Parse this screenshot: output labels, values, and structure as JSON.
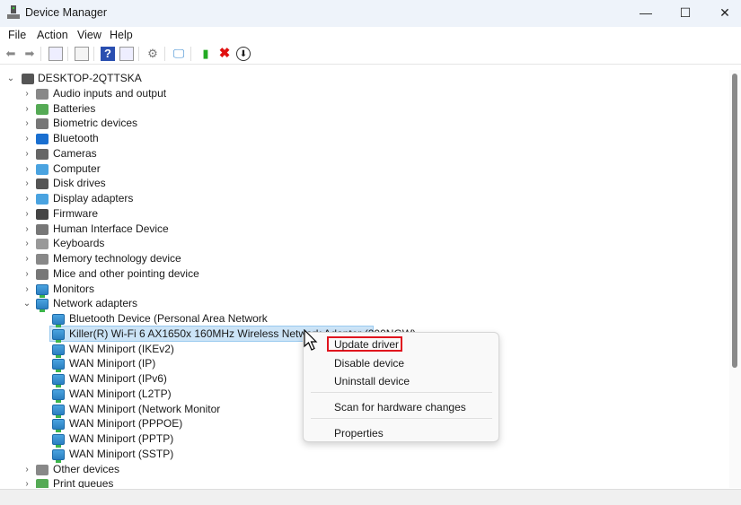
{
  "window": {
    "title": "Device Manager",
    "minimize": "—",
    "maximize": "☐",
    "close": "✕"
  },
  "menubar": [
    "File",
    "Action",
    "View",
    "Help"
  ],
  "toolbar": [
    "back-icon",
    "forward-icon",
    "show-hide-console-tree-icon",
    "properties-icon",
    "help-icon",
    "action-pane-icon",
    "update-driver-icon",
    "scan-hardware-icon",
    "enable-device-icon",
    "uninstall-icon",
    "disable-device-icon"
  ],
  "tree": {
    "root": "DESKTOP-2QTTSKA",
    "categories": [
      "Audio inputs and output",
      "Batteries",
      "Biometric devices",
      "Bluetooth",
      "Cameras",
      "Computer",
      "Disk drives",
      "Display adapters",
      "Firmware",
      "Human Interface Device",
      "Keyboards",
      "Memory technology device",
      "Mice and other pointing device",
      "Monitors",
      "Network adapters"
    ],
    "network_children": [
      "Bluetooth Device (Personal Area Network",
      "Killer(R) Wi-Fi 6 AX1650x 160MHz Wireless Network Adapter (200NGW)",
      "WAN Miniport (IKEv2)",
      "WAN Miniport (IP)",
      "WAN Miniport (IPv6)",
      "WAN Miniport (L2TP)",
      "WAN Miniport (Network Monitor",
      "WAN Miniport (PPPOE)",
      "WAN Miniport (PPTP)",
      "WAN Miniport (SSTP)"
    ],
    "after": [
      "Other devices",
      "Print queues"
    ]
  },
  "context_menu": {
    "update": "Update driver",
    "disable": "Disable device",
    "uninstall": "Uninstall device",
    "scan": "Scan for hardware changes",
    "properties": "Properties"
  },
  "colors": {
    "highlight": "#e0141e",
    "selection": "#cce4f7"
  }
}
